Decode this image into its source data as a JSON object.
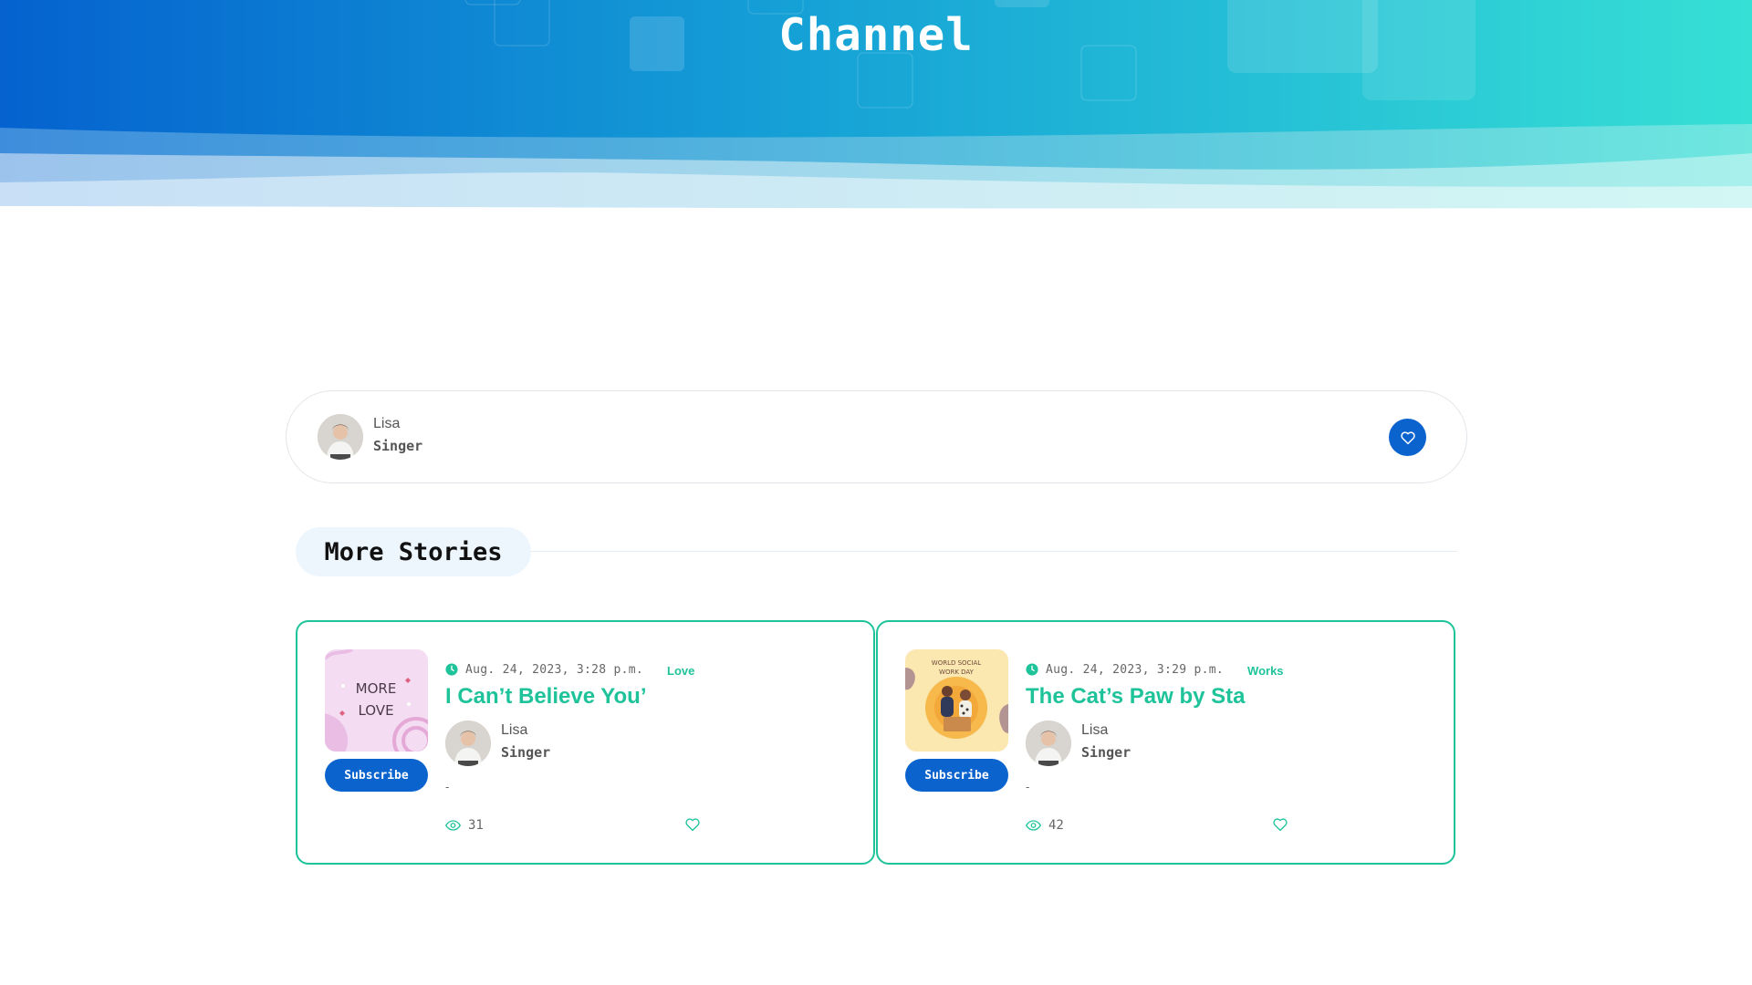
{
  "page": {
    "title": "Channel"
  },
  "profile": {
    "name": "Lisa",
    "role": "Singer",
    "favorite_icon": "heart-icon"
  },
  "section": {
    "heading": "More Stories"
  },
  "stories": [
    {
      "thumb_text": [
        "MORE",
        "LOVE"
      ],
      "subscribe_label": "Subscribe",
      "date": "Aug. 24, 2023, 3:28 p.m.",
      "category": "Love",
      "title": "I Can’t Believe You’",
      "author": {
        "name": "Lisa",
        "role": "Singer"
      },
      "excerpt": "-",
      "views": "31"
    },
    {
      "thumb_text": [
        "WORLD SOCIAL",
        "WORK DAY"
      ],
      "subscribe_label": "Subscribe",
      "date": "Aug. 24, 2023, 3:29 p.m.",
      "category": "Works",
      "title": "The Cat’s Paw by Sta",
      "author": {
        "name": "Lisa",
        "role": "Singer"
      },
      "excerpt": "-",
      "views": "42"
    }
  ],
  "colors": {
    "primary": "#0b63ce",
    "accent": "#1ec39a",
    "hero_start": "#0562cf",
    "hero_end": "#36e0d5"
  }
}
